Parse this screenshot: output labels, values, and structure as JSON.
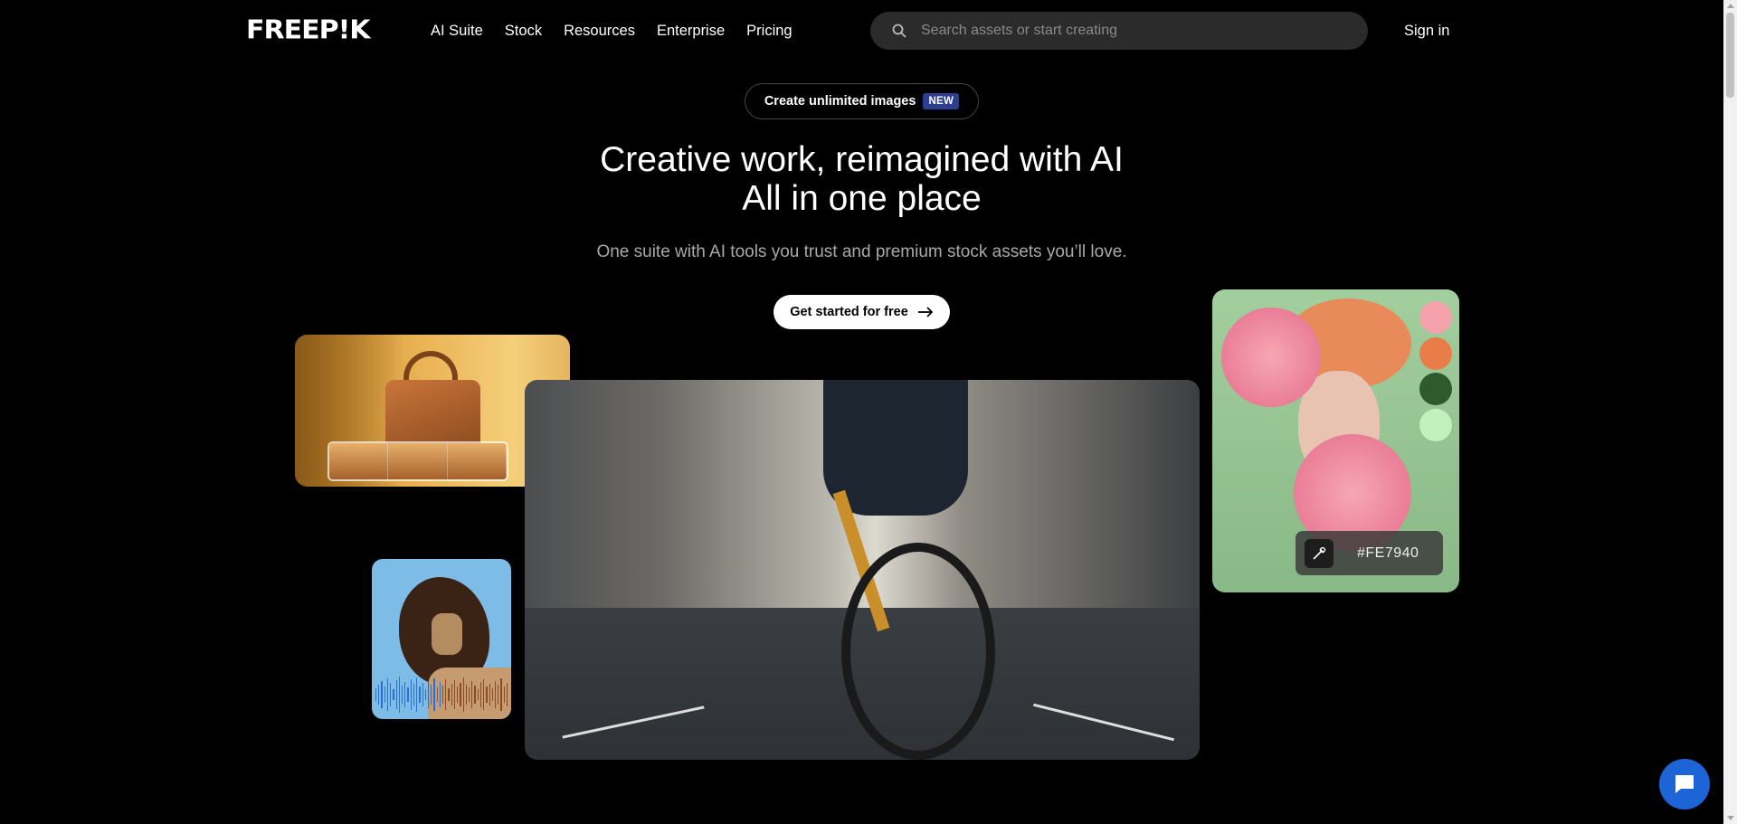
{
  "header": {
    "logo": "FREEP!K",
    "nav": [
      "AI Suite",
      "Stock",
      "Resources",
      "Enterprise",
      "Pricing"
    ],
    "search_placeholder": "Search assets or start creating",
    "signin": "Sign in"
  },
  "hero": {
    "pill_text": "Create unlimited images",
    "pill_badge": "NEW",
    "title_line1": "Creative work, reimagined with AI",
    "title_line2": "All in one place",
    "subtitle": "One suite with AI tools you trust and premium stock assets you’ll love.",
    "cta": "Get started for free"
  },
  "portrait_card": {
    "swatches": [
      "#f4a3ad",
      "#e87d4a",
      "#2f5a2c",
      "#c3f1bd"
    ],
    "hex_value": "#FE7940"
  },
  "colors": {
    "background": "#000000",
    "badge": "#2c3e8f",
    "chat": "#1d64d6"
  }
}
